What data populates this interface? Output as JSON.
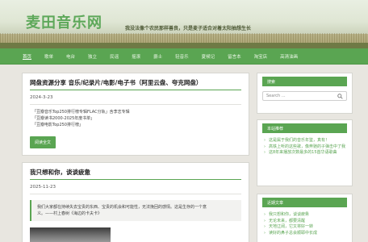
{
  "header": {
    "site_title": "麦田音乐网",
    "slogan": "我没法像个农民那样善良，只是麦子适合对着太阳抽想生长"
  },
  "nav": {
    "items": [
      "首页",
      "歌单",
      "电台",
      "独立",
      "民谣",
      "摇滚",
      "爵士",
      "轻音乐",
      "夏候记",
      "留言本",
      "淘宝店",
      "高清油画"
    ],
    "active_index": 0
  },
  "posts": [
    {
      "title": "网盘资源分享 音乐/纪录片/电影/电子书（阿里云盘、夸克网盘）",
      "date": "2024-3-23",
      "lines": [
        "「豆瓣音乐Top250排行榜专辑FLAC分轨」含李志专辑",
        "「豆瓣读书2000-2025年度书单」",
        "「豆瓣电影Top250排行榜」"
      ],
      "read_more": "阅读全文"
    },
    {
      "title": "我只想和你，谈谈疲惫",
      "date": "2025-11-23",
      "quote_lines": [
        "我们大家都在持续失去宝贵的东西、宝贵的机会和可能性，无法挽回的感情。这是生存的一个意",
        "义。——村上春树《海边的卡夫卡》"
      ]
    }
  ],
  "sidebar": {
    "search": {
      "title": "搜索",
      "placeholder": "Search ..."
    },
    "recommended": {
      "title": "本站推荐",
      "items": [
        "这是属于我们的音乐年鉴，真有！",
        "高铁上听的这些歌，像奔驰的子弹击中了我",
        "这8年来播放次数最多的15首华语歌曲"
      ]
    },
    "recent": {
      "title": "近期文章",
      "items": [
        "我只想和你，谈谈疲惫",
        "无论未来，都要清醒",
        "天地辽阔，它又将好一转",
        "读好的鼻子总会顺耶中长成"
      ]
    }
  },
  "colors": {
    "accent": "#5aa552",
    "title_green": "#5ea85a",
    "background": "#e8e6e0"
  }
}
